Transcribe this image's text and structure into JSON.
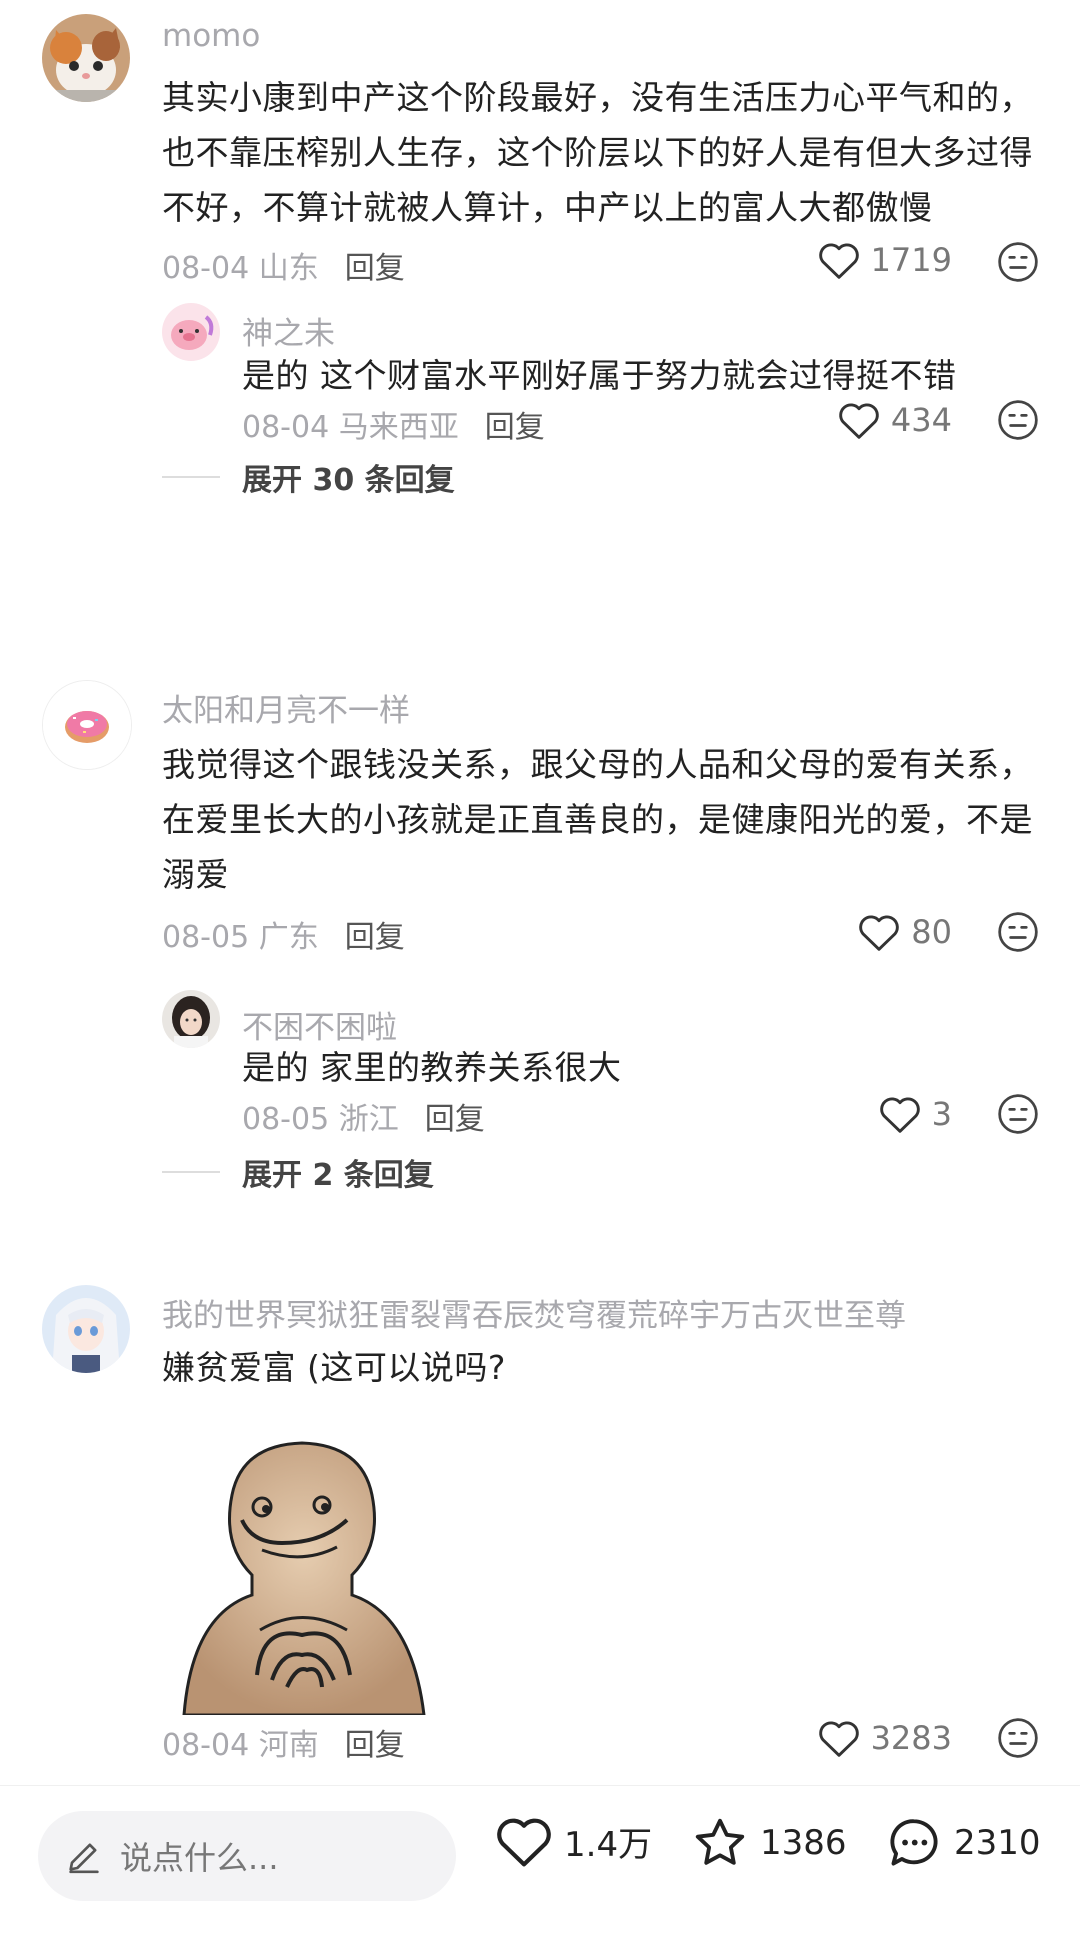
{
  "comments": [
    {
      "username": "momo",
      "text": "其实小康到中产这个阶段最好，没有生活压力心平气和的，也不靠压榨别人生存，这个阶层以下的好人是有但大多过得不好，不算计就被人算计，中产以上的富人大都傲慢",
      "date_region": "08-04 山东",
      "reply_label": "回复",
      "likes": "1719",
      "replies": [
        {
          "username": "神之未",
          "text": "是的 这个财富水平刚好属于努力就会过得挺不错",
          "date_region": "08-04 马来西亚",
          "reply_label": "回复",
          "likes": "434"
        }
      ],
      "expand_label": "展开 30 条回复"
    },
    {
      "username": "太阳和月亮不一样",
      "text": "我觉得这个跟钱没关系，跟父母的人品和父母的爱有关系，在爱里长大的小孩就是正直善良的，是健康阳光的爱，不是溺爱",
      "date_region": "08-05 广东",
      "reply_label": "回复",
      "likes": "80",
      "replies": [
        {
          "username": "不困不困啦",
          "text": "是的  家里的教养关系很大",
          "date_region": "08-05 浙江",
          "reply_label": "回复",
          "likes": "3"
        }
      ],
      "expand_label": "展开 2 条回复"
    },
    {
      "username": "我的世界冥狱狂雷裂霄吞辰焚穹覆荒碎宇万古灭世至尊",
      "text": "嫌贫爱富 (这可以说吗?",
      "date_region": "08-04 河南",
      "reply_label": "回复",
      "likes": "3283"
    }
  ],
  "bottom_bar": {
    "input_placeholder": "说点什么...",
    "likes": "1.4万",
    "favorites": "1386",
    "comments": "2310"
  },
  "icons": {
    "like": "heart-outline-icon",
    "dislike": "meh-face-icon",
    "edit": "pencil-icon",
    "favorite": "star-outline-icon",
    "comment": "speech-bubble-icon"
  }
}
